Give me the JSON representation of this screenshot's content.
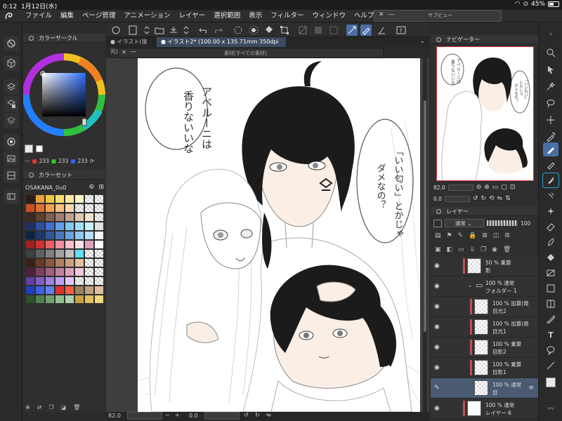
{
  "status": {
    "time": "0:12",
    "date": "1月12日(水)",
    "battery": "45%"
  },
  "menu": {
    "items": [
      "ファイル",
      "編集",
      "ページ管理",
      "アニメーション",
      "レイヤー",
      "選択範囲",
      "表示",
      "フィルター",
      "ウィンドウ",
      "ヘルプ"
    ]
  },
  "subview": {
    "title": "サブビュー"
  },
  "color_circle": {
    "title": "カラーサークル",
    "rgb": [
      "233",
      "233",
      "233"
    ]
  },
  "color_set": {
    "title": "カラーセット",
    "set_name": "OSAKANA_0u0"
  },
  "tabs": {
    "tab1": "イラスト(復元)*",
    "tab2": "イラスト2* (100.00 x 135.71mm 350dpi 82.0%)"
  },
  "material": {
    "title": "素材[すべての素材]"
  },
  "canvas": {
    "speech1": [
      "アベルーニは",
      "香りないいな"
    ],
    "speech2": [
      "「いい匂い」とかじゃ",
      "ダメなの？"
    ],
    "nav_speech1": [
      "アベルーニは",
      "香りないいな"
    ],
    "nav_speech2": [
      "「いい匂い」",
      "とかじゃ",
      "ダメなの？"
    ]
  },
  "bottom": {
    "zoom": "82.0",
    "angle": "0.0"
  },
  "navigator": {
    "title": "ナビゲーター",
    "zoom": "82.0",
    "angle": "0.0"
  },
  "layers": {
    "title": "レイヤー",
    "blend": "通常",
    "opacity": "100",
    "rows": [
      {
        "mode": "50 % 乗算",
        "name": "影"
      },
      {
        "mode": "100 % 通常",
        "name": "フォルダー 1"
      },
      {
        "mode": "100 % 加算(発",
        "name": "目光2"
      },
      {
        "mode": "100 % 加算(発",
        "name": "目光1"
      },
      {
        "mode": "100 % 乗算",
        "name": "目影2"
      },
      {
        "mode": "100 % 乗算",
        "name": "目影1"
      },
      {
        "mode": "100 % 通常",
        "name": "目"
      },
      {
        "mode": "100 % 通常",
        "name": "レイヤー 6"
      }
    ]
  },
  "colors": {
    "accent": "#4a6fa5",
    "selected_row": "#4a5a70",
    "hair": "#1a1a1a",
    "skin": "#fbeee4"
  }
}
